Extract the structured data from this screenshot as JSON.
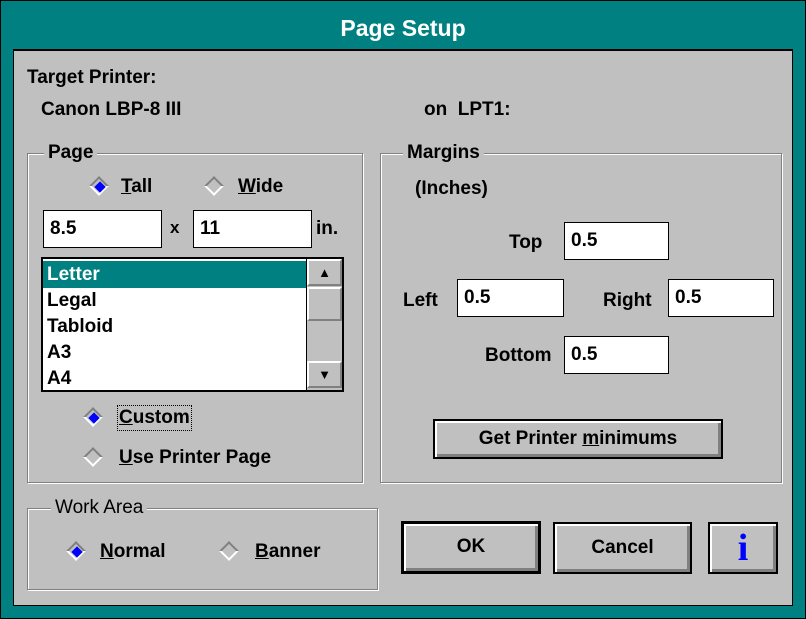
{
  "window": {
    "title": "Page Setup"
  },
  "printer": {
    "label": "Target Printer:",
    "name": "Canon LBP-8 III",
    "port": "on  LPT1:"
  },
  "page": {
    "group_title": "Page",
    "orientation": {
      "tall": {
        "pre": "",
        "mnemonic": "T",
        "post": "all",
        "selected": true
      },
      "wide": {
        "pre": "",
        "mnemonic": "W",
        "post": "ide",
        "selected": false
      }
    },
    "width": "8.5",
    "times": "x",
    "height": "11",
    "unit": "in.",
    "sizes": [
      "Letter",
      "Legal",
      "Tabloid",
      "A3",
      "A4"
    ],
    "selected_size": "Letter",
    "custom": {
      "mnemonic": "C",
      "post": "ustom",
      "selected": true
    },
    "use_printer_page": {
      "mnemonic": "U",
      "post": "se Printer Page",
      "selected": false
    }
  },
  "margins": {
    "group_title": "Margins",
    "units": "(Inches)",
    "top_label": "Top",
    "top": "0.5",
    "left_label": "Left",
    "left": "0.5",
    "right_label": "Right",
    "right": "0.5",
    "bottom_label": "Bottom",
    "bottom": "0.5",
    "get_minimums": {
      "pre": "Get Printer ",
      "mnemonic": "m",
      "post": "inimums"
    }
  },
  "work_area": {
    "group_title": "Work Area",
    "normal": {
      "mnemonic": "N",
      "post": "ormal",
      "selected": true
    },
    "banner": {
      "mnemonic": "B",
      "post": "anner",
      "selected": false
    }
  },
  "buttons": {
    "ok": "OK",
    "cancel": "Cancel",
    "info": "i"
  },
  "colors": {
    "title_bar": "#008080",
    "face": "#c0c0c0",
    "selection": "#008080",
    "radio_dot": "#0000ff",
    "info_icon": "#0000ff"
  }
}
